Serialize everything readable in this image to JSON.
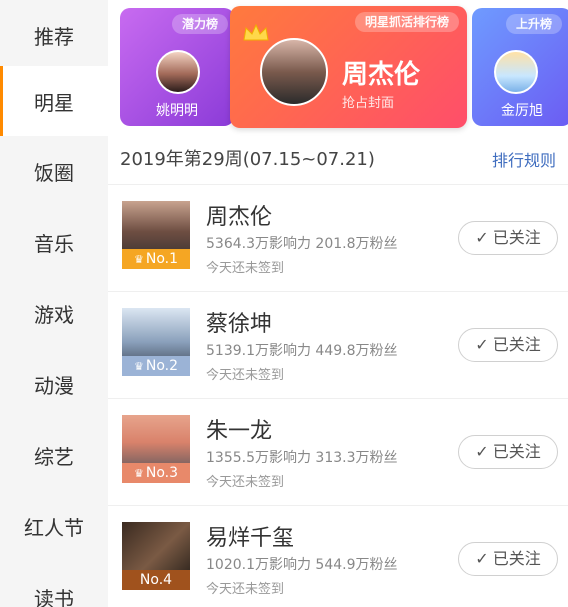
{
  "sidebar": {
    "items": [
      {
        "label": "推荐"
      },
      {
        "label": "明星",
        "active": true
      },
      {
        "label": "饭圈"
      },
      {
        "label": "音乐"
      },
      {
        "label": "游戏"
      },
      {
        "label": "动漫"
      },
      {
        "label": "综艺"
      },
      {
        "label": "红人节"
      },
      {
        "label": "读书"
      }
    ]
  },
  "banner": {
    "left": {
      "tag": "潜力榜",
      "name": "姚明明"
    },
    "center": {
      "tag": "明星抓活排行榜",
      "title": "周杰伦",
      "subtitle": "抢占封面",
      "icon": "crown-icon"
    },
    "right": {
      "tag": "上升榜",
      "name": "金厉旭"
    }
  },
  "week": {
    "title": "2019年第29周(07.15~07.21)",
    "rules_link": "排行规则"
  },
  "list": [
    {
      "rank": "No.1",
      "name": "周杰伦",
      "stats": "5364.3万影响力 201.8万粉丝",
      "checkin": "今天还未签到",
      "follow_label": "已关注",
      "badge_color": "#f5a623"
    },
    {
      "rank": "No.2",
      "name": "蔡徐坤",
      "stats": "5139.1万影响力 449.8万粉丝",
      "checkin": "今天还未签到",
      "follow_label": "已关注",
      "badge_color": "#9bb3d6"
    },
    {
      "rank": "No.3",
      "name": "朱一龙",
      "stats": "1355.5万影响力 313.3万粉丝",
      "checkin": "今天还未签到",
      "follow_label": "已关注",
      "badge_color": "#e8896a"
    },
    {
      "rank": "No.4",
      "name": "易烊千玺",
      "stats": "1020.1万影响力 544.9万粉丝",
      "checkin": "今天还未签到",
      "follow_label": "已关注",
      "badge_color": "#a0521d"
    }
  ],
  "colors": {
    "accent": "#ff8a00",
    "link": "#3f6dbf"
  }
}
